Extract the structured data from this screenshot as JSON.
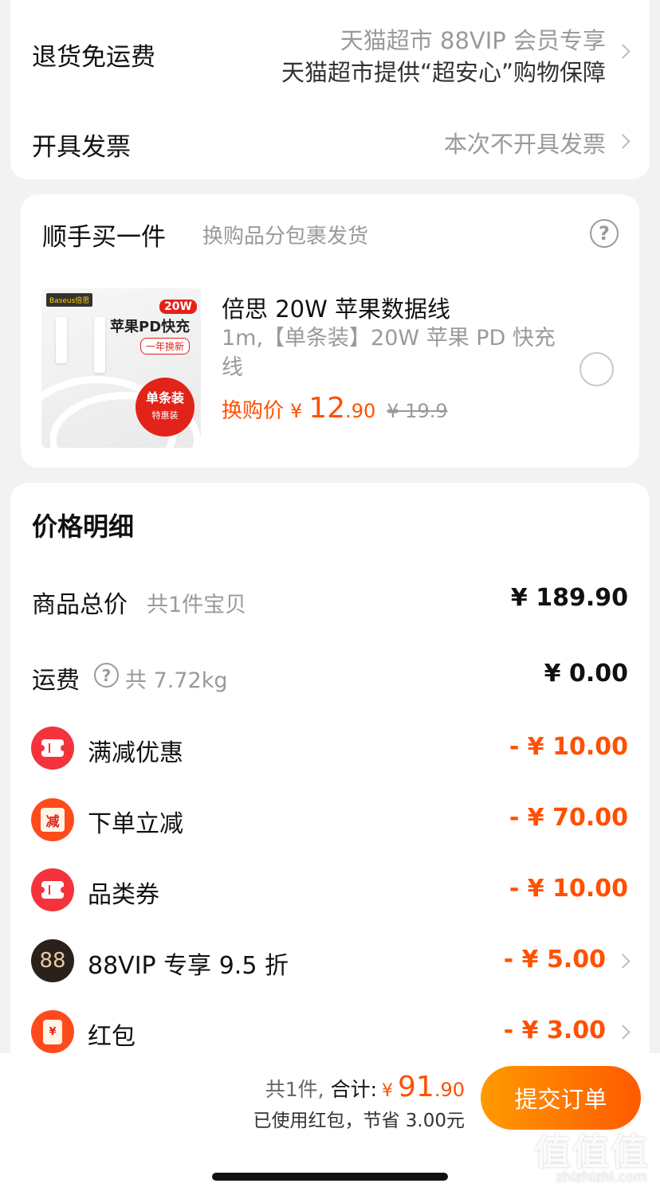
{
  "service": {
    "return_label": "退货免运费",
    "return_line1": "天猫超市 88VIP 会员专享",
    "return_line2": "天猫超市提供“超安心”购物保障",
    "invoice_label": "开具发票",
    "invoice_value": "本次不开具发票"
  },
  "addon": {
    "title": "顺手买一件",
    "subtitle": "换购品分包裹发货",
    "help_icon": "help-circle-icon",
    "product": {
      "image_brand": "Baseus倍思",
      "image_badge": "20W",
      "image_title": "苹果PD快充",
      "image_tag": "一年换新",
      "image_pack": "单条装",
      "image_pack_sub": "特惠装",
      "name": "倍思 20W 苹果数据线",
      "spec": "1m,【单条装】20W 苹果 PD 快充线",
      "price_label": "换购价",
      "currency": "¥",
      "price_int": "12",
      "price_dec": ".90",
      "original_price": "¥ 19.9"
    }
  },
  "price_detail": {
    "title": "价格明细",
    "goods_total_label": "商品总价",
    "goods_total_note": "共1件宝贝",
    "goods_total_value": "¥ 189.90",
    "shipping_label": "运费",
    "shipping_note": "共 7.72kg",
    "shipping_value": "¥ 0.00",
    "discounts": [
      {
        "label": "满减优惠",
        "value": "- ¥ 10.00",
        "icon": "coupon-ticket-icon"
      },
      {
        "label": "下单立减",
        "value": "- ¥ 70.00",
        "icon": "reduce-badge-icon",
        "icon_text": "减"
      },
      {
        "label": "品类券",
        "value": "- ¥ 10.00",
        "icon": "coupon-ticket-icon"
      },
      {
        "label": "88VIP 专享 9.5 折",
        "value": "- ¥ 5.00",
        "icon": "vip-88-icon",
        "icon_text": "88"
      },
      {
        "label": "红包",
        "value": "- ¥ 3.00",
        "icon": "red-envelope-icon",
        "icon_text": "¥"
      }
    ]
  },
  "footer": {
    "count_text": "共1件,",
    "total_label": "合计:",
    "currency": "¥",
    "total_int": "91",
    "total_dec": ".90",
    "saving_note": "已使用红包，节省 3.00元",
    "submit_label": "提交订单"
  },
  "watermark": {
    "logo": "值值值",
    "site": "zhizhizhi.com"
  },
  "colors": {
    "accent": "#ff5000",
    "red_icon": "#f4333c",
    "vip_dark": "#2b211c",
    "background": "#f2f2f2"
  }
}
